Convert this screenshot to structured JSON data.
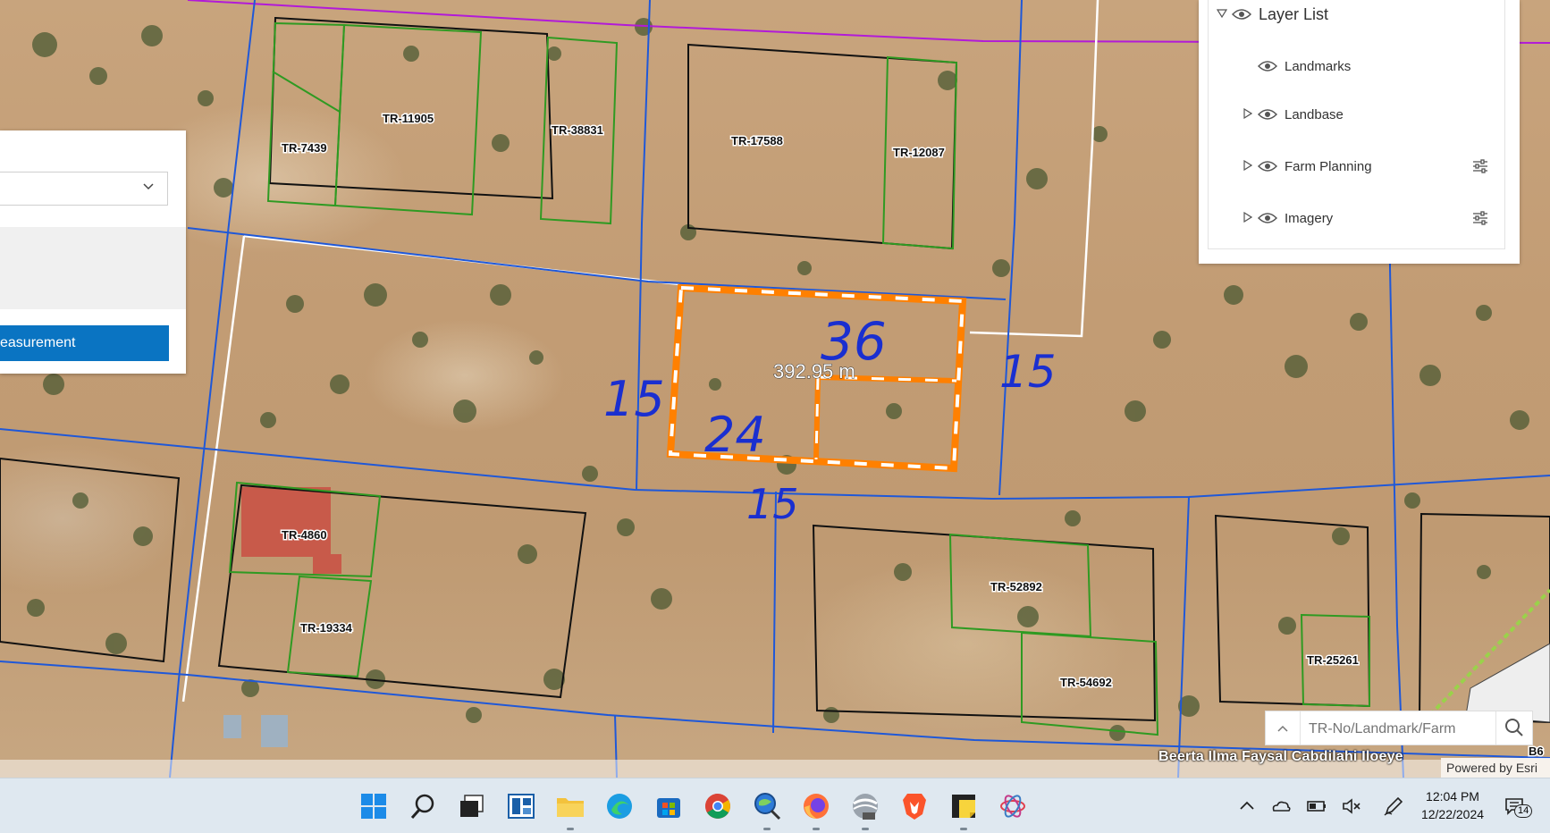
{
  "map": {
    "parcels": [
      {
        "id": "p1",
        "label": "TR-7439"
      },
      {
        "id": "p2",
        "label": "TR-11905"
      },
      {
        "id": "p3",
        "label": "TR-38831"
      },
      {
        "id": "p4",
        "label": "TR-17588"
      },
      {
        "id": "p5",
        "label": "TR-12087"
      },
      {
        "id": "p6",
        "label": "TR-4860"
      },
      {
        "id": "p7",
        "label": "TR-19334"
      },
      {
        "id": "p8",
        "label": "TR-52892"
      },
      {
        "id": "p9",
        "label": "TR-54692"
      },
      {
        "id": "p10",
        "label": "TR-25261"
      }
    ],
    "measurement_label": "392.95 m",
    "handwritten": [
      "36",
      "15",
      "15",
      "24",
      "15"
    ],
    "partial_label": "B6",
    "colors": {
      "measure": "#ff8000",
      "road": "#1f58d8",
      "parcel_black": "#111111",
      "parcel_green": "#2f9a22",
      "boundary": "#b21ad8"
    }
  },
  "measure_panel": {
    "button_label": "easurement",
    "dropdown_icon": "chevron-down-icon"
  },
  "layer_list": {
    "title": "Layer List",
    "items": [
      {
        "label": "Landmarks",
        "expandable": false,
        "options": false
      },
      {
        "label": "Landbase",
        "expandable": true,
        "options": false
      },
      {
        "label": "Farm Planning",
        "expandable": true,
        "options": true
      },
      {
        "label": "Imagery",
        "expandable": true,
        "options": true
      }
    ]
  },
  "search": {
    "placeholder": "TR-No/Landmark/Farm"
  },
  "attribution": {
    "credit": "Beerta Ilma Faysal Cabdilahi Iloeye",
    "powered_by": "Powered by Esri"
  },
  "taskbar": {
    "apps": [
      "windows-start-icon",
      "search-icon",
      "task-view-icon",
      "widgets-icon",
      "file-explorer-icon",
      "edge-icon",
      "store-icon",
      "chrome-icon",
      "map-search-app-icon",
      "firefox-icon",
      "pro-app-icon",
      "brave-icon",
      "sticky-notes-icon",
      "tool-app-icon"
    ],
    "time": "12:04 PM",
    "date": "12/22/2024",
    "notifications": "14"
  }
}
